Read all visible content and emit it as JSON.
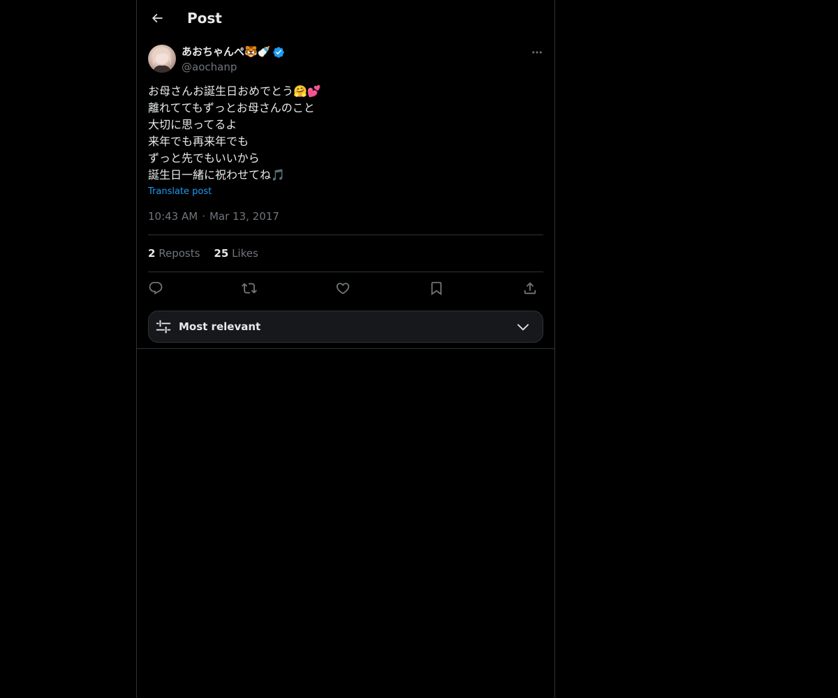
{
  "header": {
    "title": "Post"
  },
  "post": {
    "author": {
      "display_name": "あおちゃんぺ🐯🍼",
      "handle": "@aochanp",
      "verified": true
    },
    "text_lines": [
      "お母さんお誕生日おめでとう🤗💕",
      "離れててもずっとお母さんのこと",
      "大切に思ってるよ",
      "来年でも再来年でも",
      "ずっと先でもいいから",
      "誕生日一緒に祝わせてね🎵"
    ],
    "translate_label": "Translate post",
    "time": "10:43 AM",
    "separator": "·",
    "date": "Mar 13, 2017",
    "stats": {
      "reposts_count": "2",
      "reposts_label": "Reposts",
      "likes_count": "25",
      "likes_label": "Likes"
    }
  },
  "actions": [
    "reply-icon",
    "repost-icon",
    "like-icon",
    "bookmark-icon",
    "share-icon"
  ],
  "sort": {
    "label": "Most relevant"
  },
  "colors": {
    "background": "#000000",
    "text": "#e7e9ea",
    "muted": "#71767b",
    "link": "#1d9bf0",
    "border": "#2f3336",
    "verified": "#1d9bf0"
  }
}
